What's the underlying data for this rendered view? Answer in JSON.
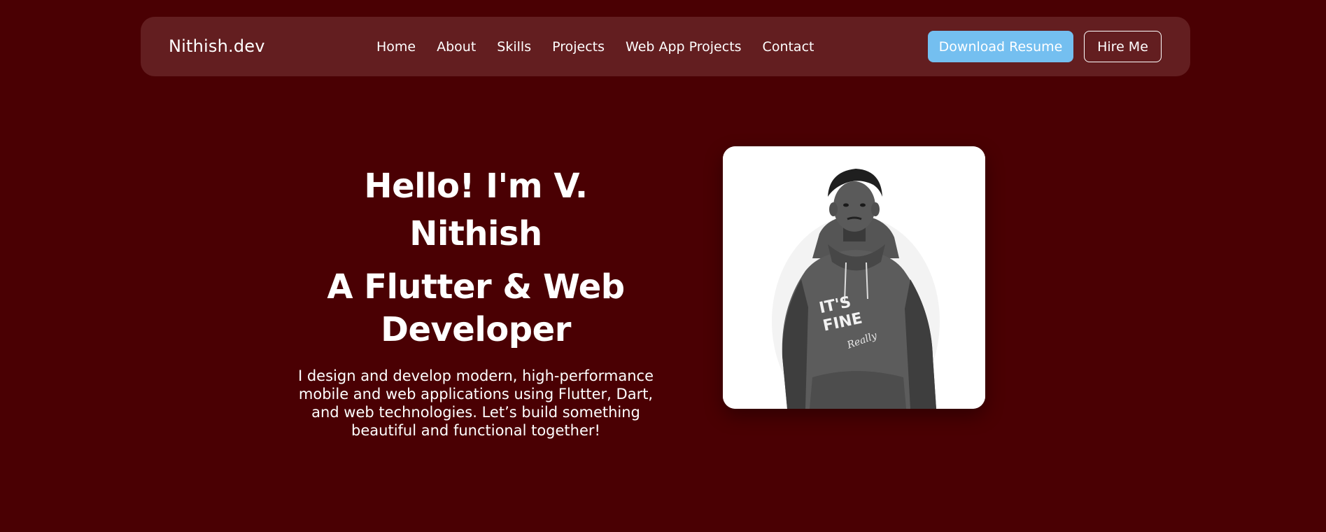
{
  "navbar": {
    "brand": "Nithish.dev",
    "links": [
      "Home",
      "About",
      "Skills",
      "Projects",
      "Web App Projects",
      "Contact"
    ],
    "download_resume_label": "Download Resume",
    "hire_me_label": "Hire Me"
  },
  "hero": {
    "greeting": "Hello! I'm V. Nithish",
    "role": "A Flutter & Web Developer",
    "description": "I design and develop modern, high-performance mobile and web applications using Flutter, Dart, and web technologies. Let’s build something beautiful and functional together!",
    "photo": {
      "hoodie_print_line1": "IT'S",
      "hoodie_print_line2": "FINE",
      "hoodie_print_script": "Really"
    }
  },
  "colors": {
    "page_background": "#4a0003",
    "navbar_background": "#631e20",
    "resume_button": "#74bff0",
    "text": "#ffffff"
  }
}
